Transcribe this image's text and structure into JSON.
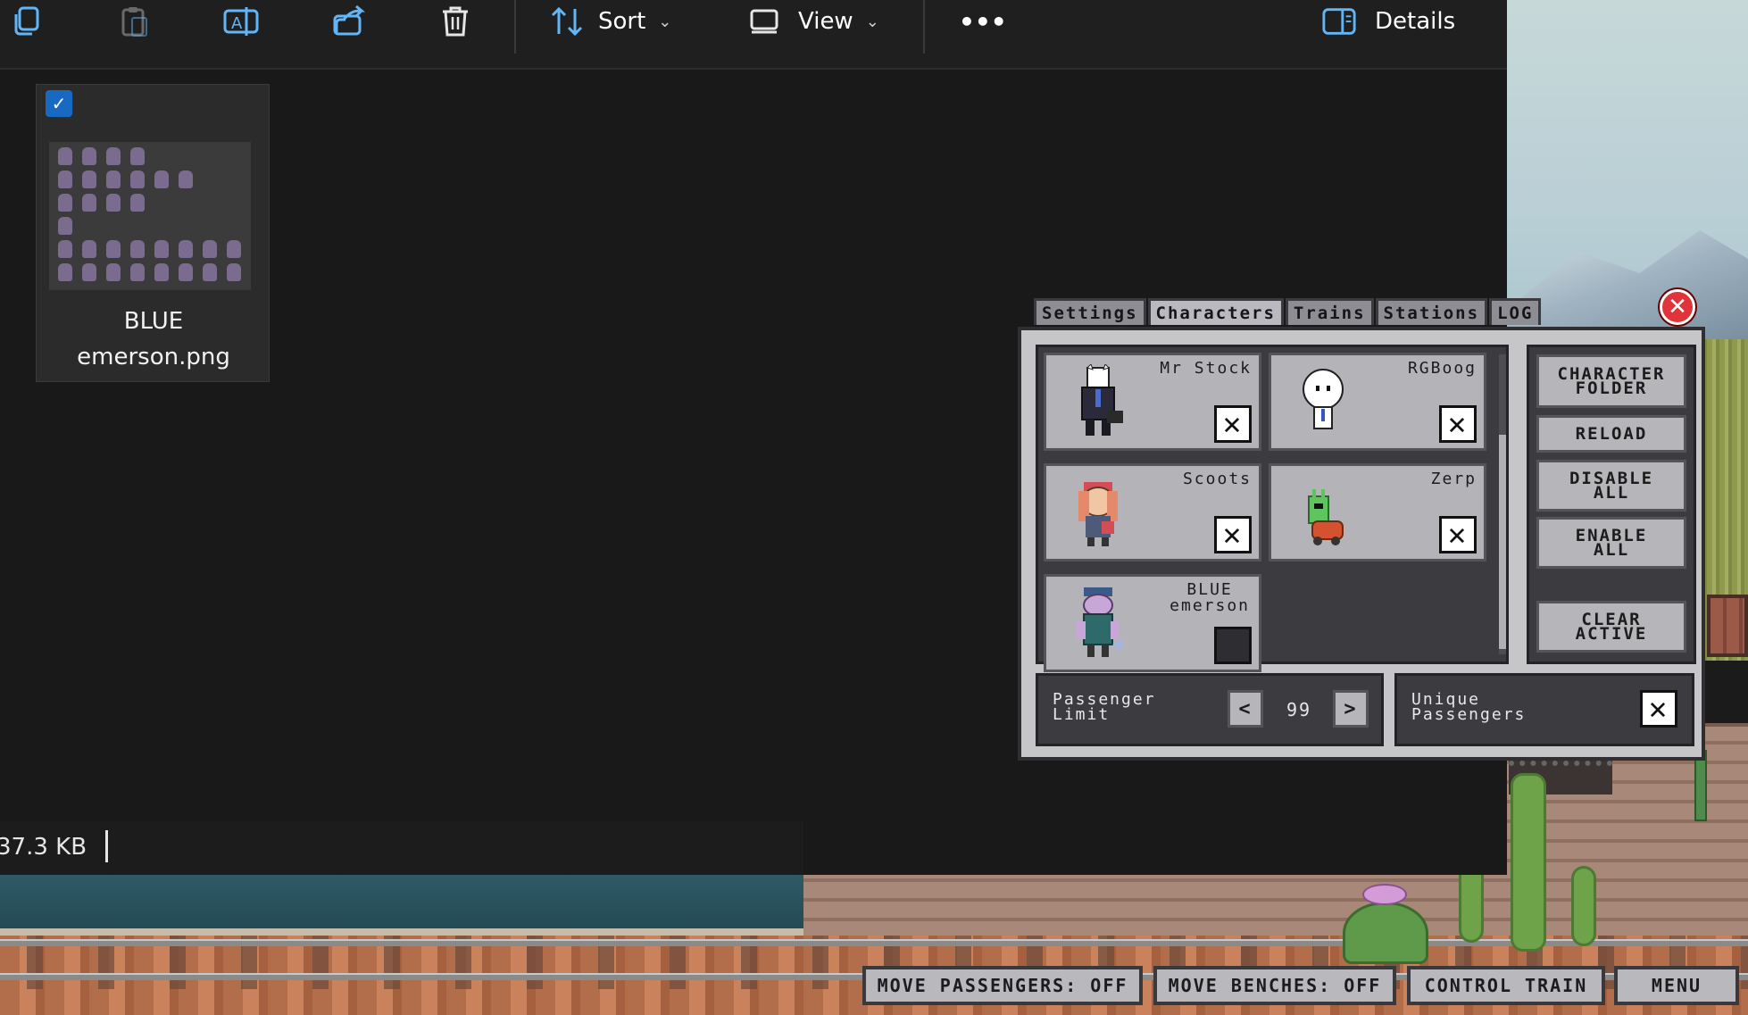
{
  "toolbar": {
    "items": [
      {
        "name": "copy-button",
        "icon": "copy-icon"
      },
      {
        "name": "paste-button",
        "icon": "paste-icon"
      },
      {
        "name": "rename-button",
        "icon": "rename-icon"
      },
      {
        "name": "share-button",
        "icon": "share-icon"
      },
      {
        "name": "delete-button",
        "icon": "trash-icon"
      }
    ],
    "sort_label": "Sort",
    "view_label": "View",
    "more_label": "•••",
    "details_label": "Details"
  },
  "file": {
    "name_line1": "BLUE",
    "name_line2": "emerson.png",
    "checked": true
  },
  "status": {
    "size": "37.3 KB"
  },
  "game_panel": {
    "tabs": [
      "Settings",
      "Characters",
      "Trains",
      "Stations",
      "LOG"
    ],
    "active_tab": "Characters",
    "characters": [
      {
        "name": "Mr Stock",
        "enabled": true
      },
      {
        "name": "RGBoog",
        "enabled": true
      },
      {
        "name": "Scoots",
        "enabled": true
      },
      {
        "name": "Zerp",
        "enabled": true
      },
      {
        "name_line1": "BLUE",
        "name_line2": "emerson",
        "enabled": false
      }
    ],
    "side_buttons": {
      "character_folder_1": "CHARACTER",
      "character_folder_2": "FOLDER",
      "reload": "RELOAD",
      "disable_all_1": "DISABLE",
      "disable_all_2": "ALL",
      "enable_all_1": "ENABLE",
      "enable_all_2": "ALL",
      "clear_active_1": "CLEAR",
      "clear_active_2": "ACTIVE"
    },
    "passenger_limit_label_1": "Passenger",
    "passenger_limit_label_2": "Limit",
    "passenger_limit_value": "99",
    "stepper_prev": "<",
    "stepper_next": ">",
    "unique_passengers_label_1": "Unique",
    "unique_passengers_label_2": "Passengers",
    "unique_passengers_enabled": true,
    "toggle_on_glyph": "✕"
  },
  "action_bar": {
    "move_passengers": "MOVE PASSENGERS: OFF",
    "move_benches": "MOVE BENCHES: OFF",
    "control_train": "CONTROL TRAIN",
    "menu": "MENU"
  },
  "colors": {
    "accent_blue": "#1769c2",
    "close_red": "#e0343a",
    "panel_grey": "#c6c6c9"
  }
}
